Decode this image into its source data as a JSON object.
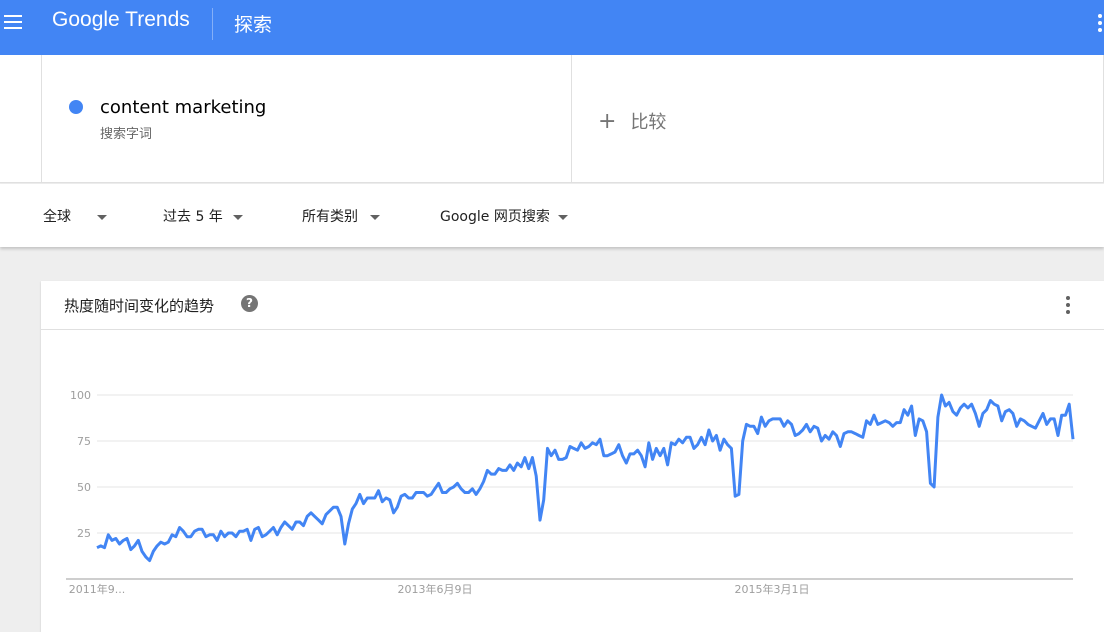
{
  "header": {
    "logo": "Google Trends",
    "page_label": "探索",
    "accent_color": "#4285f4"
  },
  "search": {
    "term": "content marketing",
    "term_type": "搜索字词",
    "term_color": "#4285f4",
    "compare_label": "比较"
  },
  "filters": {
    "region": "全球",
    "time_range": "过去 5 年",
    "category": "所有类别",
    "search_type": "Google 网页搜索"
  },
  "card": {
    "title": "热度随时间变化的趋势",
    "help_glyph": "?"
  },
  "chart_data": {
    "type": "line",
    "title": "热度随时间变化的趋势",
    "ylim": [
      0,
      100
    ],
    "yticks": [
      25,
      50,
      75,
      100
    ],
    "grid": true,
    "x_tick_labels": [
      "2011年9...",
      "2013年6月9日",
      "2015年3月1日"
    ],
    "series": [
      {
        "name": "content marketing",
        "color": "#4285f4",
        "values": [
          17,
          18,
          17,
          24,
          21,
          22,
          19,
          21,
          22,
          16,
          18,
          21,
          15,
          12,
          10,
          15,
          18,
          20,
          19,
          20,
          24,
          23,
          28,
          26,
          23,
          23,
          26,
          27,
          27,
          23,
          24,
          24,
          21,
          26,
          23,
          25,
          25,
          23,
          26,
          26,
          27,
          21,
          27,
          28,
          23,
          24,
          26,
          28,
          24,
          28,
          31,
          29,
          27,
          31,
          31,
          29,
          34,
          36,
          34,
          32,
          30,
          35,
          37,
          39,
          39,
          34,
          19,
          30,
          38,
          41,
          46,
          41,
          44,
          44,
          44,
          48,
          42,
          44,
          43,
          36,
          39,
          45,
          46,
          44,
          44,
          47,
          47,
          47,
          45,
          46,
          49,
          52,
          47,
          47,
          49,
          50,
          52,
          49,
          47,
          47,
          49,
          46,
          49,
          53,
          59,
          57,
          57,
          60,
          59,
          59,
          62,
          59,
          63,
          61,
          66,
          60,
          66,
          56,
          32,
          43,
          71,
          67,
          70,
          65,
          65,
          66,
          72,
          71,
          70,
          74,
          71,
          72,
          74,
          73,
          76,
          67,
          67,
          68,
          69,
          73,
          67,
          63,
          68,
          68,
          70,
          67,
          61,
          74,
          65,
          71,
          67,
          71,
          62,
          74,
          73,
          76,
          74,
          77,
          77,
          71,
          73,
          77,
          73,
          81,
          75,
          78,
          70,
          76,
          73,
          71,
          45,
          46,
          75,
          84,
          83,
          83,
          79,
          88,
          83,
          86,
          87,
          87,
          87,
          83,
          86,
          84,
          78,
          79,
          81,
          84,
          80,
          83,
          82,
          75,
          78,
          76,
          80,
          78,
          72,
          79,
          80,
          80,
          79,
          78,
          77,
          86,
          84,
          89,
          84,
          85,
          86,
          85,
          83,
          85,
          85,
          92,
          89,
          94,
          78,
          87,
          86,
          80,
          52,
          50,
          88,
          100,
          94,
          96,
          91,
          89,
          93,
          95,
          93,
          95,
          90,
          83,
          90,
          92,
          97,
          95,
          94,
          86,
          91,
          92,
          90,
          83,
          87,
          86,
          84,
          83,
          82,
          86,
          90,
          84,
          87,
          87,
          78,
          89,
          89,
          95,
          76
        ]
      }
    ]
  }
}
